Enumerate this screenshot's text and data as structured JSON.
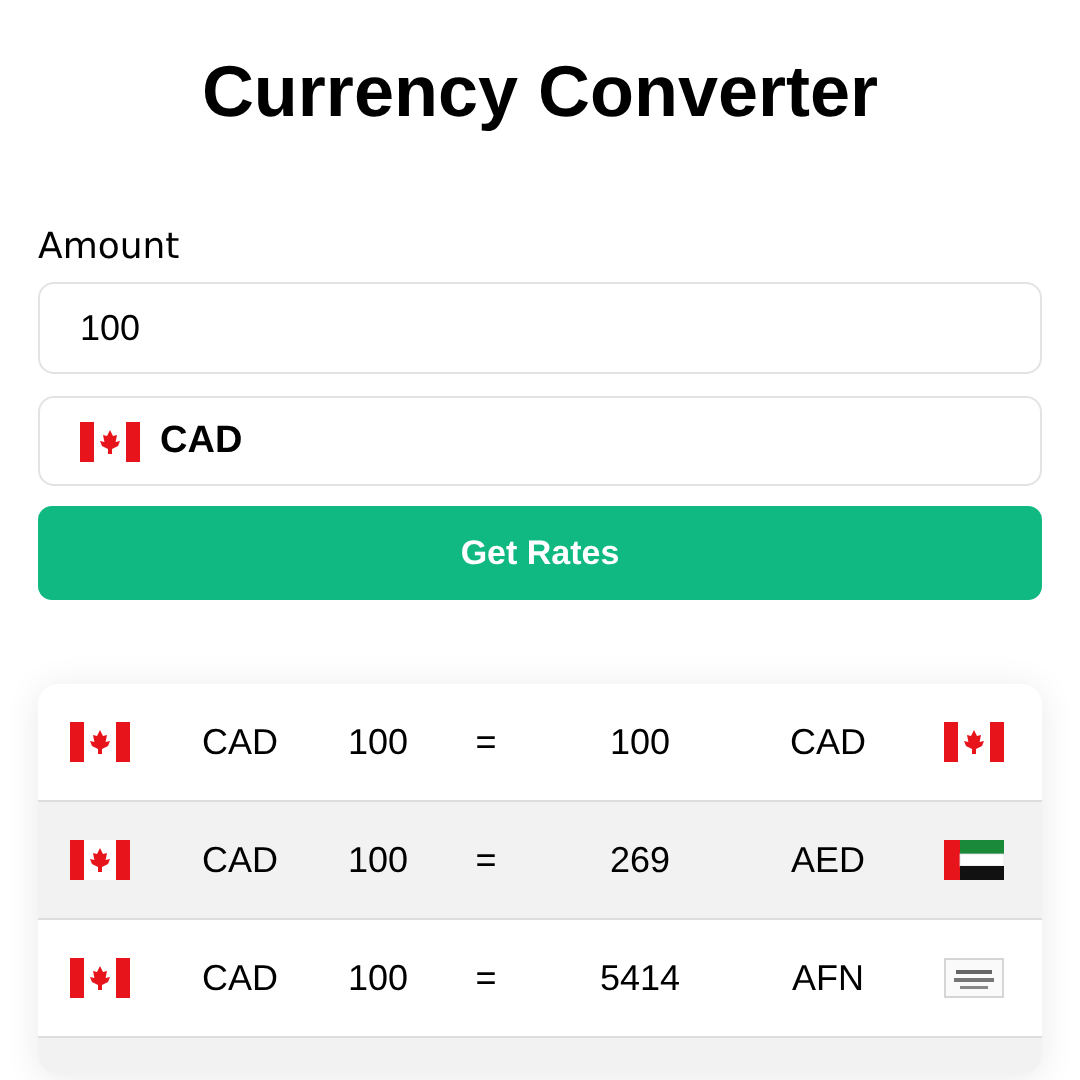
{
  "title": "Currency Converter",
  "amount": {
    "label": "Amount",
    "value": "100"
  },
  "currency_select": {
    "value": "CAD"
  },
  "button": "Get Rates",
  "rates": [
    {
      "from": "CAD",
      "amount": "100",
      "equals": "=",
      "result": "100",
      "to": "CAD",
      "kind": "ca"
    },
    {
      "from": "CAD",
      "amount": "100",
      "equals": "=",
      "result": "269",
      "to": "AED",
      "kind": "ae"
    },
    {
      "from": "CAD",
      "amount": "100",
      "equals": "=",
      "result": "5414",
      "to": "AFN",
      "kind": "af"
    }
  ]
}
